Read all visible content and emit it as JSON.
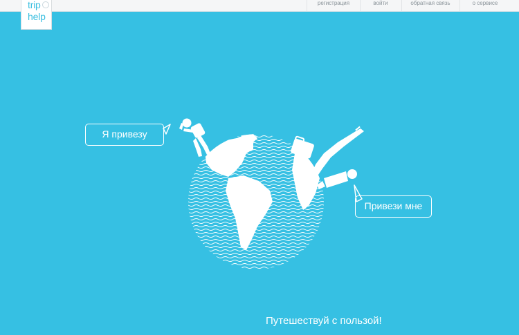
{
  "logo": {
    "line1": "trip",
    "line2": "help"
  },
  "nav": {
    "items": [
      {
        "label": "регистрация"
      },
      {
        "label": "войти"
      },
      {
        "label": "обратная связь"
      },
      {
        "label": "о сервисе"
      }
    ]
  },
  "bubbles": {
    "left": "Я привезу",
    "right": "Привези мне"
  },
  "tagline": "Путешествуй с пользой!",
  "colors": {
    "background": "#36c0e3",
    "topbar": "#f5f6f7",
    "logo_text": "#3cbfe0",
    "foreground": "#ffffff"
  }
}
